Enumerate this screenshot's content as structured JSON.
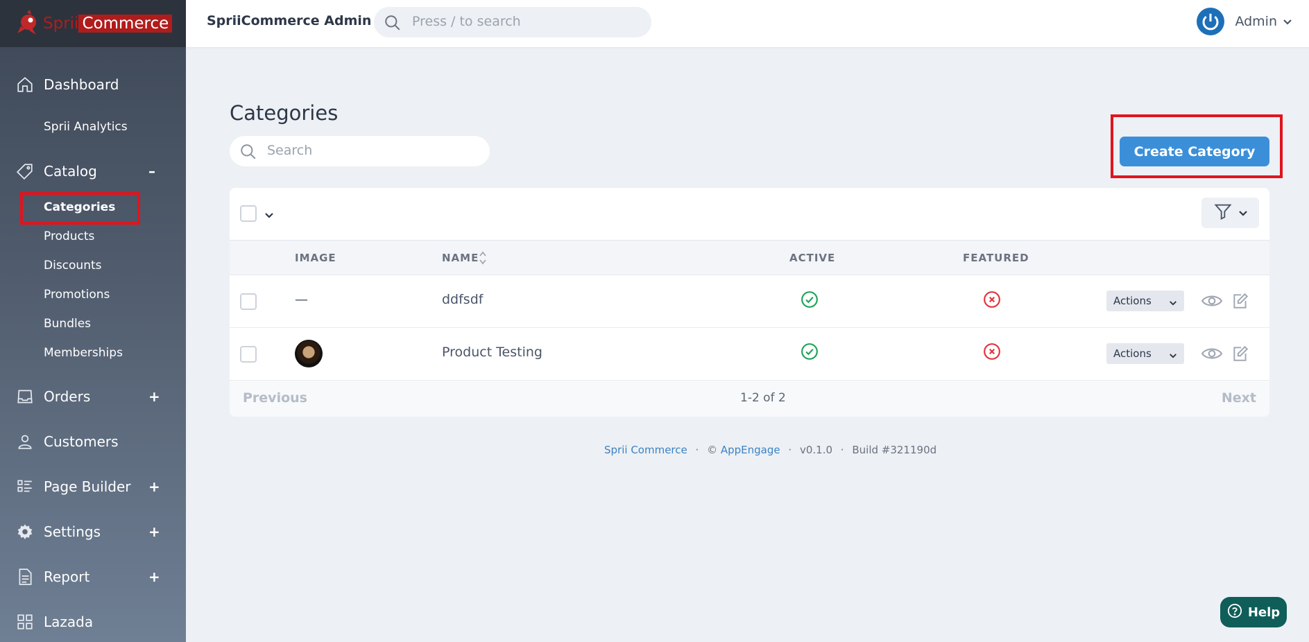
{
  "brand": {
    "name_part1": "Sprii",
    "name_part2": "Commerce"
  },
  "topbar": {
    "title": "SpriiCommerce Admin",
    "search_placeholder": "Press / to search",
    "user_name": "Admin"
  },
  "sidebar": {
    "dashboard": "Dashboard",
    "sprii_analytics": "Sprii Analytics",
    "catalog": "Catalog",
    "catalog_toggle": "–",
    "catalog_items": [
      "Categories",
      "Products",
      "Discounts",
      "Promotions",
      "Bundles",
      "Memberships"
    ],
    "orders": "Orders",
    "customers": "Customers",
    "page_builder": "Page Builder",
    "settings": "Settings",
    "report": "Report",
    "lazada": "Lazada",
    "expand_toggle": "+"
  },
  "page": {
    "title": "Categories",
    "search_placeholder": "Search",
    "create_button": "Create Category"
  },
  "table": {
    "columns": {
      "image": "IMAGE",
      "name": "NAME",
      "active": "ACTIVE",
      "featured": "FEATURED"
    },
    "rows": [
      {
        "image": "—",
        "name": "ddfsdf",
        "active": true,
        "featured": false,
        "actions": "Actions"
      },
      {
        "image": "coffee-cup-thumbnail",
        "name": "Product Testing",
        "active": true,
        "featured": false,
        "actions": "Actions"
      }
    ],
    "pager": {
      "previous": "Previous",
      "info": "1-2 of 2",
      "next": "Next"
    }
  },
  "footer": {
    "brand_link": "Sprii Commerce",
    "copyright": "©",
    "company_link": "AppEngage",
    "version": "v0.1.0",
    "build": "Build #321190d",
    "separator": "·"
  },
  "help": {
    "label": "Help"
  },
  "colors": {
    "primary": "#3b8fd9",
    "brand_red": "#b01c1c",
    "success": "#22a35a",
    "danger": "#e0353b",
    "help": "#0f5e59"
  }
}
